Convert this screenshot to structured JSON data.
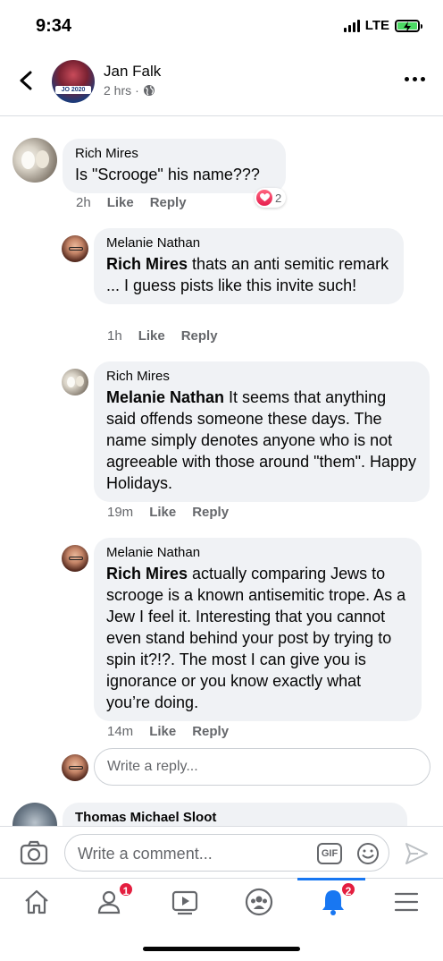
{
  "status_bar": {
    "time": "9:34",
    "network": "LTE"
  },
  "post_header": {
    "author": "Jan Falk",
    "time": "2 hrs",
    "separator": "·",
    "privacy_icon": "globe-icon",
    "avatar_text": "JO 2020"
  },
  "comments": [
    {
      "author": "Rich Mires",
      "mention": "",
      "text": "Is \"Scrooge\" his name???",
      "time": "2h",
      "like_label": "Like",
      "reply_label": "Reply",
      "reaction": {
        "icon": "heart-icon",
        "count": "2"
      }
    },
    {
      "author": "Melanie Nathan",
      "mention": "Rich Mires",
      "text": " thats an anti semitic remark ... I guess pists like this invite such!",
      "time": "1h",
      "like_label": "Like",
      "reply_label": "Reply"
    },
    {
      "author": "Rich Mires",
      "mention": "Melanie Nathan",
      "text": " It seems that anything said offends someone these days.  The name simply denotes anyone who is not agreeable with those around \"them\". Happy Holidays.",
      "time": "19m",
      "like_label": "Like",
      "reply_label": "Reply"
    },
    {
      "author": "Melanie Nathan",
      "mention": "Rich Mires",
      "text": " actually comparing Jews to scrooge is a known antisemitic trope. As a Jew I feel it. Interesting that you cannot even stand behind your post by trying to spin it?!?. The most I can give you is ignorance or you know exactly what you’re doing.",
      "time": "14m",
      "like_label": "Like",
      "reply_label": "Reply"
    },
    {
      "author": "Thomas Michael Sloot"
    }
  ],
  "reply_input": {
    "placeholder": "Write a reply..."
  },
  "comment_bar": {
    "placeholder": "Write a comment...",
    "gif_label": "GIF"
  },
  "tab_bar": {
    "tabs": [
      {
        "name": "home",
        "icon": "home-icon",
        "badge": ""
      },
      {
        "name": "friends",
        "icon": "friends-icon",
        "badge": "1"
      },
      {
        "name": "watch",
        "icon": "watch-icon",
        "badge": ""
      },
      {
        "name": "groups",
        "icon": "groups-icon",
        "badge": ""
      },
      {
        "name": "notifications",
        "icon": "bell-icon",
        "badge": "2",
        "active": true
      },
      {
        "name": "menu",
        "icon": "menu-icon",
        "badge": ""
      }
    ]
  },
  "colors": {
    "accent": "#1877f2",
    "badge": "#e41e3f",
    "bubble": "#f0f2f5",
    "muted_text": "#65676b",
    "battery": "#4cd964"
  }
}
